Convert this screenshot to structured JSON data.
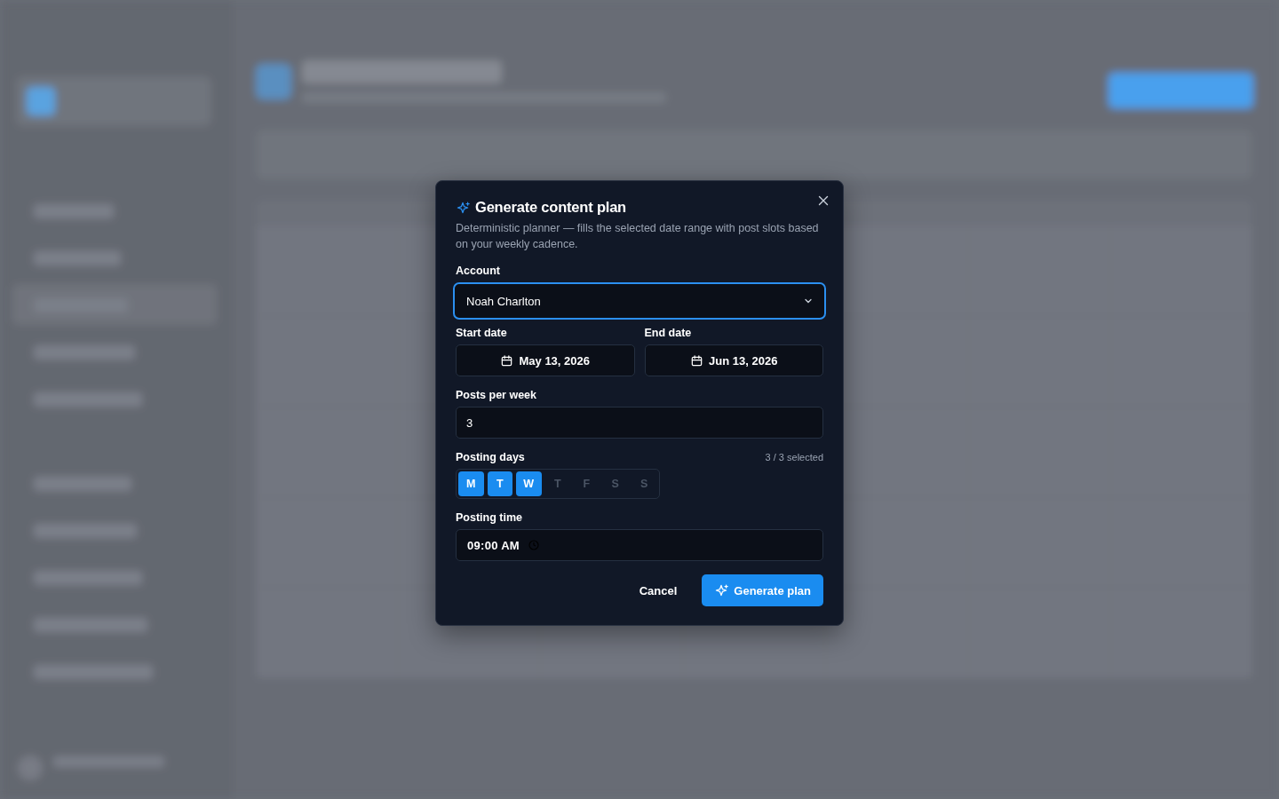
{
  "dialog": {
    "title": "Generate content plan",
    "description": "Deterministic planner — fills the selected date range with post slots based on your weekly cadence.",
    "account": {
      "label": "Account",
      "value": "Noah Charlton",
      "focused": true
    },
    "start_date": {
      "label": "Start date",
      "value": "May 13, 2026"
    },
    "end_date": {
      "label": "End date",
      "value": "Jun 13, 2026"
    },
    "posts_per_week": {
      "label": "Posts per week",
      "value": "3"
    },
    "posting_days": {
      "label": "Posting days",
      "count": "3 / 3 selected",
      "days": [
        {
          "label": "M",
          "selected": true
        },
        {
          "label": "T",
          "selected": true
        },
        {
          "label": "W",
          "selected": true
        },
        {
          "label": "T",
          "selected": false
        },
        {
          "label": "F",
          "selected": false
        },
        {
          "label": "S",
          "selected": false
        },
        {
          "label": "S",
          "selected": false
        }
      ]
    },
    "posting_time": {
      "label": "Posting time",
      "value": "09:00 AM"
    },
    "buttons": [
      {
        "kind": "secondary",
        "label": "Cancel"
      },
      {
        "kind": "primary",
        "label": "Generate plan"
      }
    ]
  }
}
